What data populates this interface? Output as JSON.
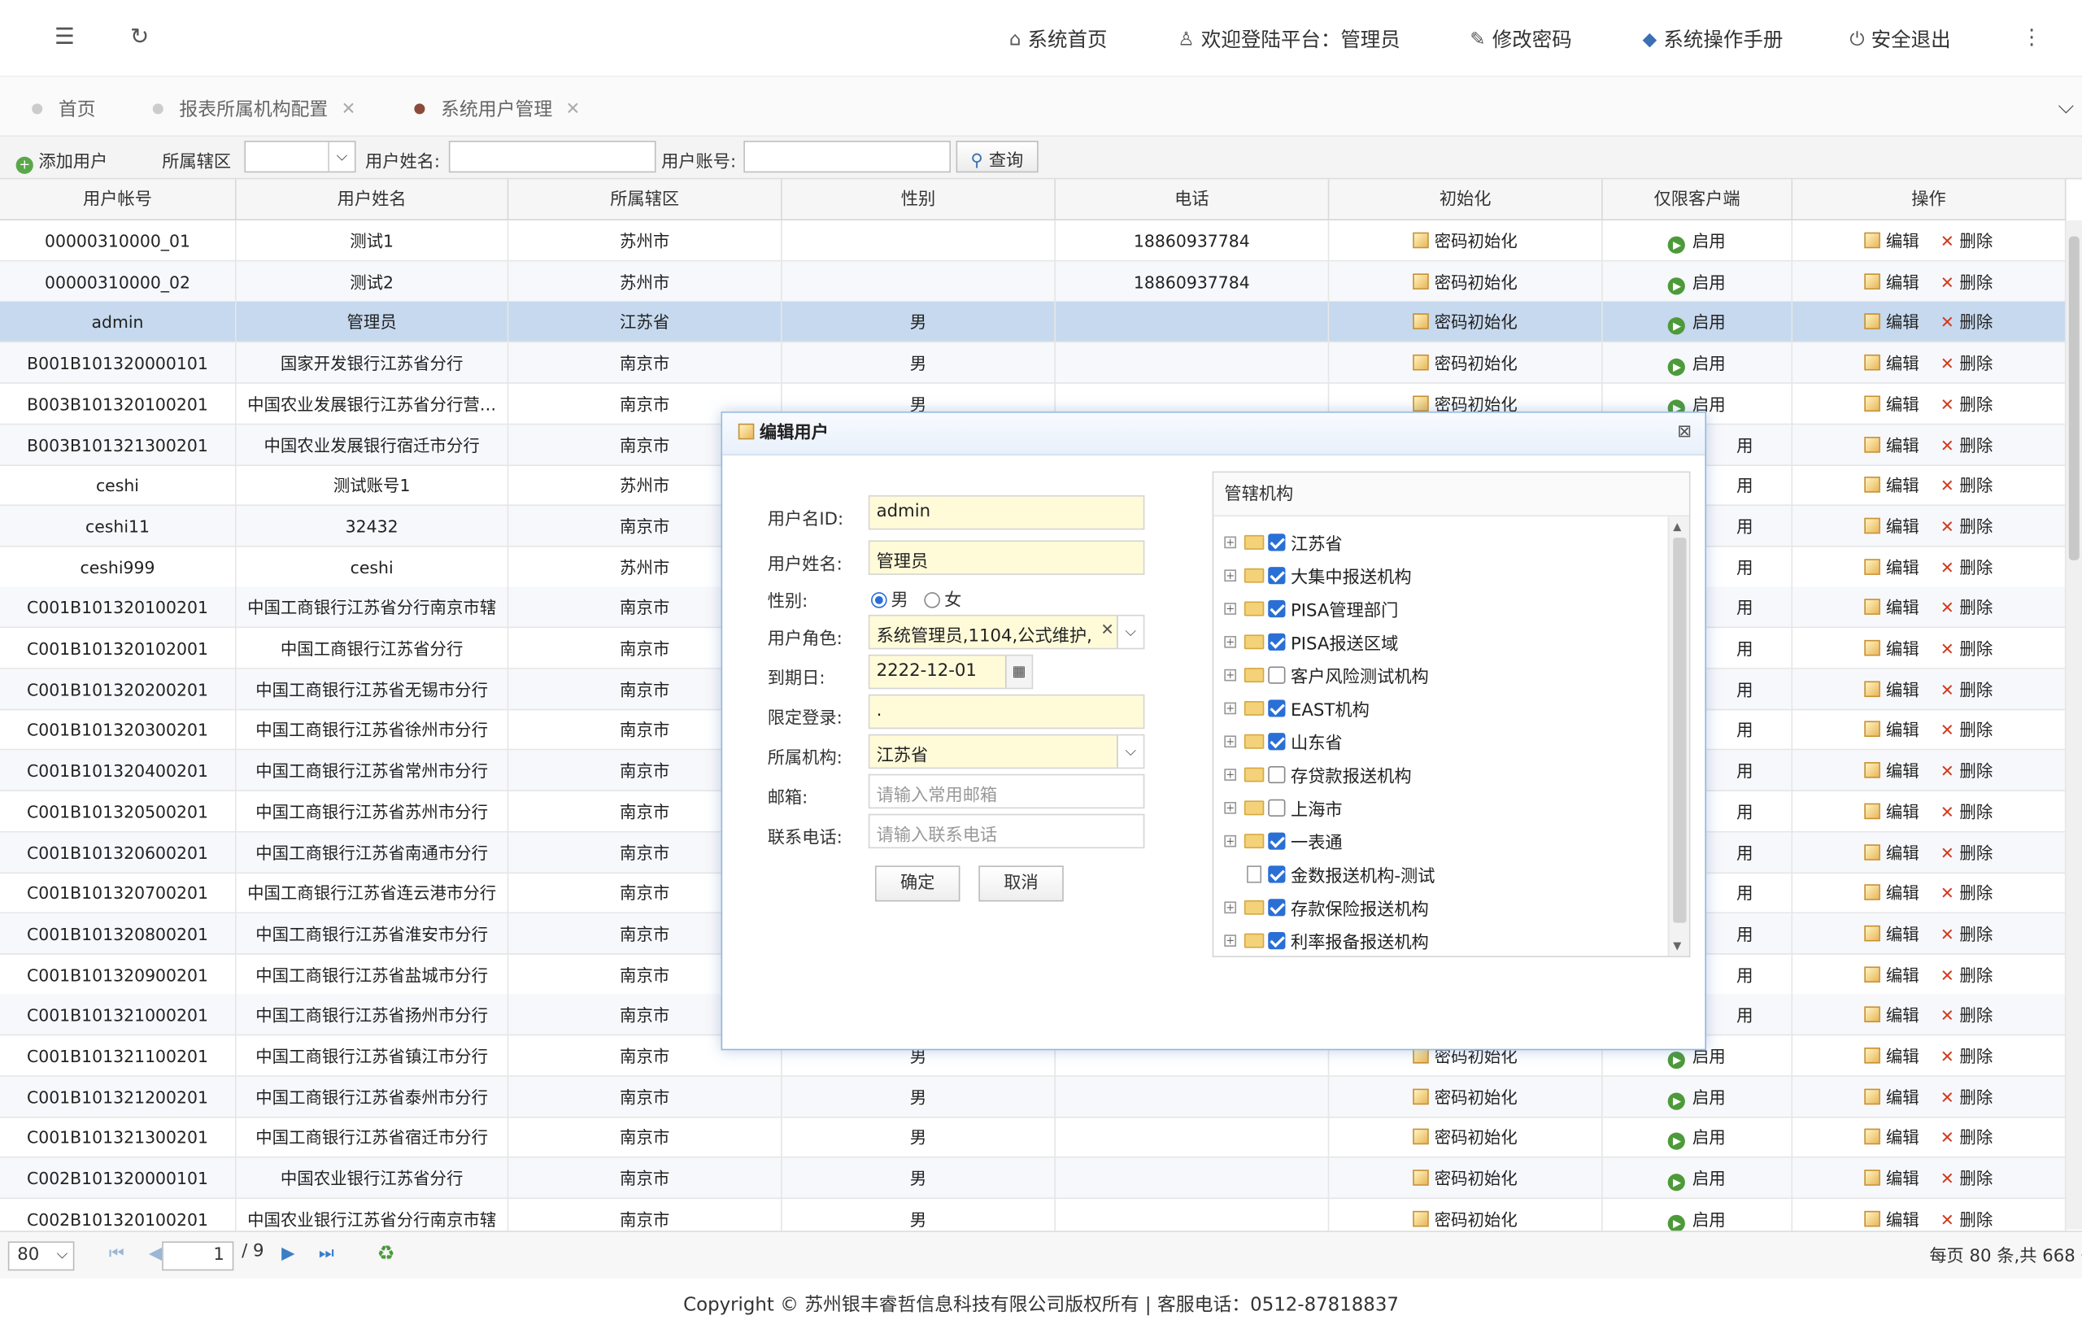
{
  "topbar": {
    "menu_icon": "hamburger-icon",
    "refresh_icon": "refresh-icon",
    "home": "系统首页",
    "welcome": "欢迎登陆平台：管理员",
    "change_pwd": "修改密码",
    "manual": "系统操作手册",
    "logout": "安全退出"
  },
  "tabs": [
    "首页",
    "报表所属机构配置",
    "系统用户管理"
  ],
  "toolbar": {
    "add_user": "添加用户",
    "region_label": "所属辖区",
    "username_label": "用户姓名:",
    "account_label": "用户账号:",
    "query": "查询"
  },
  "table": {
    "columns": [
      "用户帐号",
      "用户姓名",
      "所属辖区",
      "性别",
      "电话",
      "初始化",
      "仅限客户端",
      "操作"
    ],
    "init_label": "密码初始化",
    "enable_label": "启用",
    "edit_label": "编辑",
    "delete_label": "删除",
    "enable_partial": "用",
    "rows": [
      {
        "account": "00000310000_01",
        "name": "测试1",
        "region": "苏州市",
        "gender": "",
        "phone": "18860937784"
      },
      {
        "account": "00000310000_02",
        "name": "测试2",
        "region": "苏州市",
        "gender": "",
        "phone": "18860937784"
      },
      {
        "account": "admin",
        "name": "管理员",
        "region": "江苏省",
        "gender": "男",
        "phone": ""
      },
      {
        "account": "B001B101320000101",
        "name": "国家开发银行江苏省分行",
        "region": "南京市",
        "gender": "男",
        "phone": ""
      },
      {
        "account": "B003B101320100201",
        "name": "中国农业发展银行江苏省分行营…",
        "region": "南京市",
        "gender": "男",
        "phone": ""
      },
      {
        "account": "B003B101321300201",
        "name": "中国农业发展银行宿迁市分行",
        "region": "南京市",
        "gender": "",
        "phone": ""
      },
      {
        "account": "ceshi",
        "name": "测试账号1",
        "region": "苏州市",
        "gender": "",
        "phone": ""
      },
      {
        "account": "ceshi11",
        "name": "32432",
        "region": "南京市",
        "gender": "",
        "phone": ""
      },
      {
        "account": "ceshi999",
        "name": "ceshi",
        "region": "苏州市",
        "gender": "",
        "phone": ""
      },
      {
        "account": "C001B101320100201",
        "name": "中国工商银行江苏省分行南京市辖",
        "region": "南京市",
        "gender": "",
        "phone": ""
      },
      {
        "account": "C001B101320102001",
        "name": "中国工商银行江苏省分行",
        "region": "南京市",
        "gender": "",
        "phone": ""
      },
      {
        "account": "C001B101320200201",
        "name": "中国工商银行江苏省无锡市分行",
        "region": "南京市",
        "gender": "",
        "phone": ""
      },
      {
        "account": "C001B101320300201",
        "name": "中国工商银行江苏省徐州市分行",
        "region": "南京市",
        "gender": "",
        "phone": ""
      },
      {
        "account": "C001B101320400201",
        "name": "中国工商银行江苏省常州市分行",
        "region": "南京市",
        "gender": "",
        "phone": ""
      },
      {
        "account": "C001B101320500201",
        "name": "中国工商银行江苏省苏州市分行",
        "region": "南京市",
        "gender": "",
        "phone": ""
      },
      {
        "account": "C001B101320600201",
        "name": "中国工商银行江苏省南通市分行",
        "region": "南京市",
        "gender": "",
        "phone": ""
      },
      {
        "account": "C001B101320700201",
        "name": "中国工商银行江苏省连云港市分行",
        "region": "南京市",
        "gender": "",
        "phone": ""
      },
      {
        "account": "C001B101320800201",
        "name": "中国工商银行江苏省淮安市分行",
        "region": "南京市",
        "gender": "",
        "phone": ""
      },
      {
        "account": "C001B101320900201",
        "name": "中国工商银行江苏省盐城市分行",
        "region": "南京市",
        "gender": "",
        "phone": ""
      },
      {
        "account": "C001B101321000201",
        "name": "中国工商银行江苏省扬州市分行",
        "region": "南京市",
        "gender": "",
        "phone": ""
      },
      {
        "account": "C001B101321100201",
        "name": "中国工商银行江苏省镇江市分行",
        "region": "南京市",
        "gender": "男",
        "phone": ""
      },
      {
        "account": "C001B101321200201",
        "name": "中国工商银行江苏省泰州市分行",
        "region": "南京市",
        "gender": "男",
        "phone": ""
      },
      {
        "account": "C001B101321300201",
        "name": "中国工商银行江苏省宿迁市分行",
        "region": "南京市",
        "gender": "男",
        "phone": ""
      },
      {
        "account": "C002B101320000101",
        "name": "中国农业银行江苏省分行",
        "region": "南京市",
        "gender": "男",
        "phone": ""
      },
      {
        "account": "C002B101320100201",
        "name": "中国农业银行江苏省分行南京市辖",
        "region": "南京市",
        "gender": "男",
        "phone": ""
      }
    ]
  },
  "pager": {
    "page_size": "80",
    "current_page": "1",
    "total_pages": "/ 9",
    "summary": "每页 80 条,共 668 条"
  },
  "footer": "Copyright © 苏州银丰睿哲信息科技有限公司版权所有 | 客服电话：0512-87818837",
  "dialog": {
    "title": "编辑用户",
    "labels": {
      "user_id": "用户名ID:",
      "user_name": "用户姓名:",
      "gender": "性别:",
      "role": "用户角色:",
      "expire": "到期日:",
      "login_limit": "限定登录:",
      "org": "所属机构:",
      "email": "邮箱:",
      "phone": "联系电话:"
    },
    "values": {
      "user_id": "admin",
      "user_name": "管理员",
      "gender_male": "男",
      "gender_female": "女",
      "role": "系统管理员,1104,公式维护,",
      "expire": "2222-12-01",
      "login_limit": ".",
      "org": "江苏省"
    },
    "placeholders": {
      "email": "请输入常用邮箱",
      "phone": "请输入联系电话"
    },
    "ok": "确定",
    "cancel": "取消",
    "tree_title": "管辖机构",
    "tree": [
      {
        "label": "江苏省",
        "checked": true,
        "leaf": false
      },
      {
        "label": "大集中报送机构",
        "checked": true,
        "leaf": false
      },
      {
        "label": "PISA管理部门",
        "checked": true,
        "leaf": false
      },
      {
        "label": "PISA报送区域",
        "checked": true,
        "leaf": false
      },
      {
        "label": "客户风险测试机构",
        "checked": false,
        "leaf": false
      },
      {
        "label": "EAST机构",
        "checked": true,
        "leaf": false
      },
      {
        "label": "山东省",
        "checked": true,
        "leaf": false
      },
      {
        "label": "存贷款报送机构",
        "checked": false,
        "leaf": false
      },
      {
        "label": "上海市",
        "checked": false,
        "leaf": false
      },
      {
        "label": "一表通",
        "checked": true,
        "leaf": false
      },
      {
        "label": "金数报送机构-测试",
        "checked": true,
        "leaf": true
      },
      {
        "label": "存款保险报送机构",
        "checked": true,
        "leaf": false
      },
      {
        "label": "利率报备报送机构",
        "checked": true,
        "leaf": false
      }
    ]
  }
}
